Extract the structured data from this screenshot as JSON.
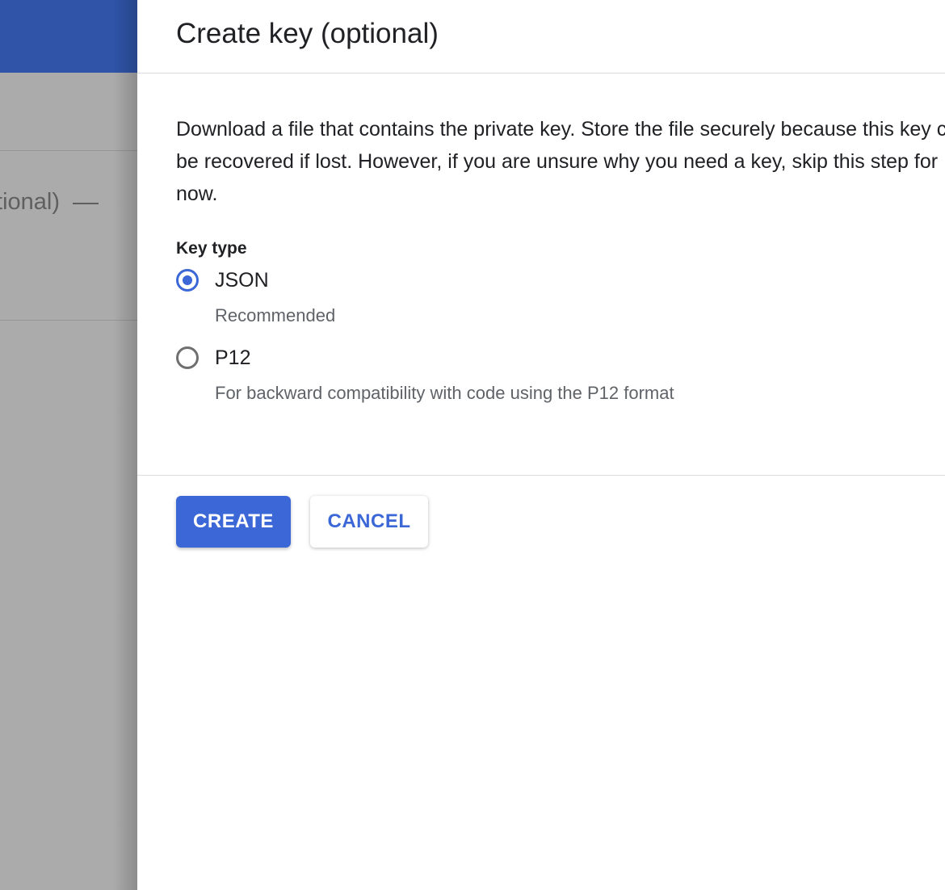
{
  "background": {
    "step_text": "(optional)"
  },
  "dialog": {
    "title": "Create key (optional)",
    "description": "Download a file that contains the private key. Store the file securely because this key can't be recovered if lost. However, if you are unsure why you need a key, skip this step for now.",
    "key_type_label": "Key type",
    "options": [
      {
        "label": "JSON",
        "hint": "Recommended",
        "selected": true
      },
      {
        "label": "P12",
        "hint": "For backward compatibility with code using the P12 format",
        "selected": false
      }
    ],
    "create_label": "CREATE",
    "cancel_label": "CANCEL"
  },
  "colors": {
    "accent": "#3c67d6",
    "header_blue": "#2f54a8",
    "scrim": "#ababab"
  }
}
